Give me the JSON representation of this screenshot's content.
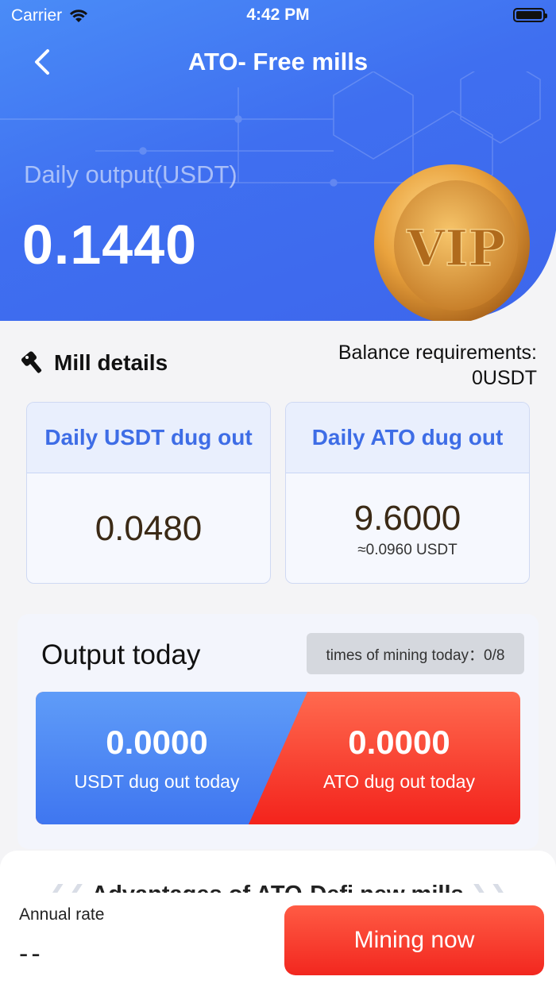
{
  "status_bar": {
    "carrier": "Carrier",
    "time": "4:42 PM"
  },
  "nav": {
    "title": "ATO- Free mills"
  },
  "hero": {
    "label": "Daily output(USDT)",
    "value": "0.1440",
    "badge_icon": "vip-coin"
  },
  "mill_details": {
    "title": "Mill details",
    "balance_line1": "Balance requirements:",
    "balance_line2": "0USDT"
  },
  "cards": {
    "usdt": {
      "title": "Daily USDT dug out",
      "value": "0.0480"
    },
    "ato": {
      "title": "Daily ATO dug out",
      "value": "9.6000",
      "sub": "≈0.0960 USDT"
    }
  },
  "output_today": {
    "title": "Output today",
    "times": "times of mining today：0/8",
    "usdt_value": "0.0000",
    "usdt_label": "USDT dug out today",
    "ato_value": "0.0000",
    "ato_label": "ATO dug out today"
  },
  "advantages": {
    "title": "Advantages of ATO-Defi new mills"
  },
  "footer": {
    "annual_label": "Annual rate",
    "annual_value": "--",
    "button_label": "Mining now"
  },
  "colors": {
    "primary_blue": "#3f6ff0",
    "accent_red": "#f2271f",
    "card_title_blue": "#3e6de6"
  }
}
